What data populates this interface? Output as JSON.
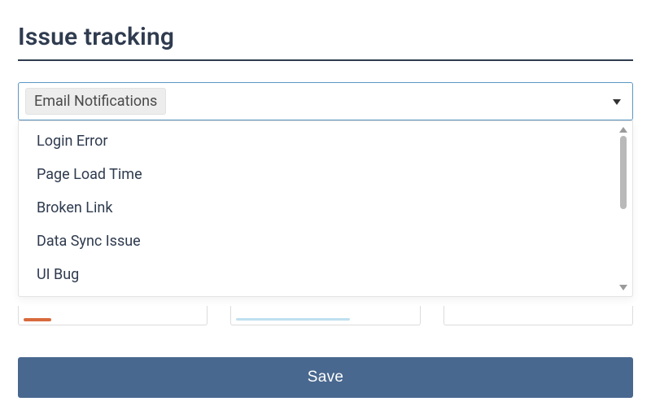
{
  "header": {
    "title": "Issue tracking"
  },
  "combo": {
    "selected_token": "Email Notifications",
    "arrow_icon": "caret-down",
    "options": [
      "Login Error",
      "Page Load Time",
      "Broken Link",
      "Data Sync Issue",
      "UI Bug"
    ]
  },
  "scrollbar": {
    "up_icon": "caret-up",
    "down_icon": "caret-down"
  },
  "buttons": {
    "save_label": "Save"
  },
  "colors": {
    "primary": "#49688f",
    "heading": "#2f3b4f",
    "focus_border": "#5c97c4",
    "token_bg": "#ededed",
    "orange_accent": "#d86a3d",
    "blue_accent": "#bfe0ef"
  }
}
